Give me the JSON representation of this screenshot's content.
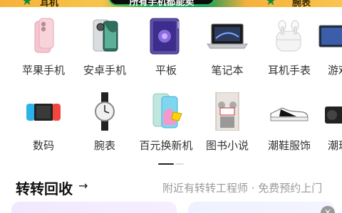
{
  "banner": {
    "left_label": "耳机",
    "pill_text": "所有手机都能卖",
    "right_label": "腕表"
  },
  "categories": [
    {
      "label": "苹果手机",
      "icon": "iphone-icon"
    },
    {
      "label": "安卓手机",
      "icon": "android-phone-icon"
    },
    {
      "label": "平板",
      "icon": "tablet-icon"
    },
    {
      "label": "笔记本",
      "icon": "laptop-icon"
    },
    {
      "label": "耳机手表",
      "icon": "earbuds-icon"
    },
    {
      "label": "游戏",
      "icon": "monitor-icon"
    },
    {
      "label": "数码",
      "icon": "game-console-icon"
    },
    {
      "label": "腕表",
      "icon": "watch-icon"
    },
    {
      "label": "百元换新机",
      "icon": "budget-phone-icon"
    },
    {
      "label": "图书小说",
      "icon": "book-icon"
    },
    {
      "label": "潮鞋服饰",
      "icon": "sneaker-icon"
    },
    {
      "label": "潮玩",
      "icon": "camera-icon"
    }
  ],
  "recycle": {
    "title": "转转回收",
    "arrow": "→",
    "subtitle": "附近有转转工程师 · 免费预约上门"
  },
  "close_icon": "×",
  "colors": {
    "banner_green": "#1d9b56",
    "banner_orange": "#f7b23a",
    "card_purple": "#f1e8ff"
  }
}
